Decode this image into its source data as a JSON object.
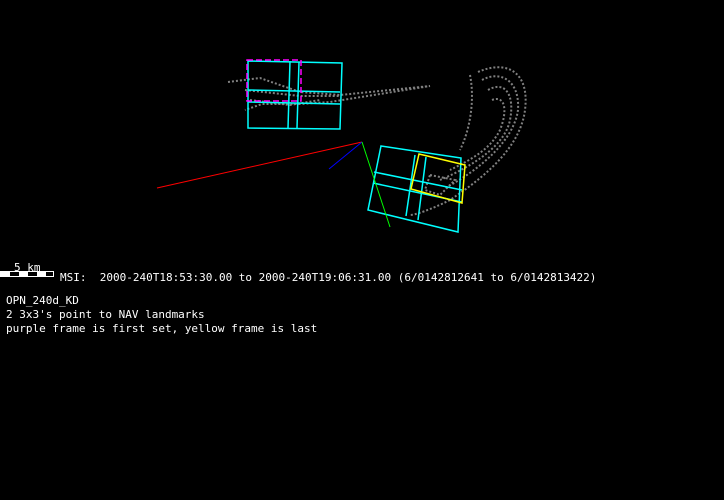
{
  "scale": {
    "label": "5 km"
  },
  "header": {
    "info": "MSI:  2000-240T18:53:30.00 to 2000-240T19:06:31.00 (6/0142812641 to 6/0142813422)"
  },
  "notes": [
    "OPN_240d_KD",
    "2 3x3's point to NAV landmarks",
    "purple frame is first set, yellow frame is last"
  ],
  "colors": {
    "frame": "#00ffff",
    "first_frame": "#ff00ff",
    "last_frame": "#ffff00",
    "asteroid": "#808080",
    "axis_x": "#ff0000",
    "axis_y": "#00ff00",
    "axis_z": "#0000ff"
  }
}
